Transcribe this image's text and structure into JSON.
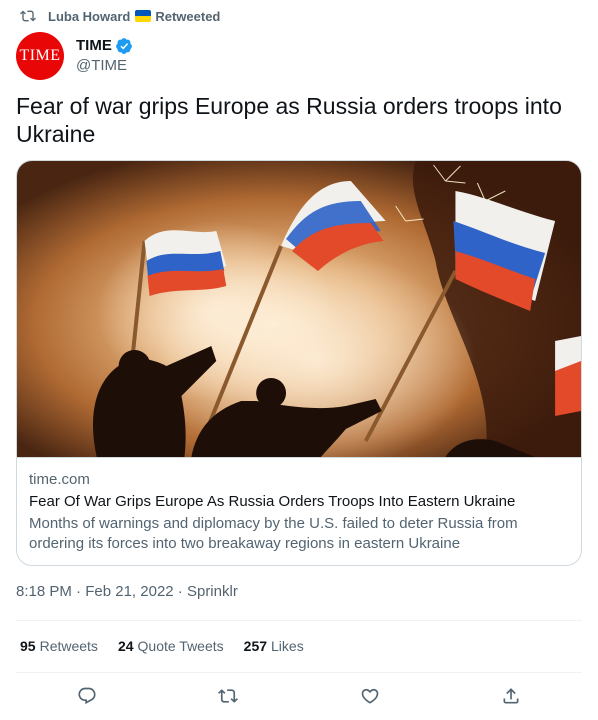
{
  "retweet_header": {
    "retweeter": "Luba Howard",
    "label": "Retweeted",
    "icon": "retweet-icon",
    "flag": "ukraine-flag-emoji"
  },
  "author": {
    "avatar_text": "TIME",
    "avatar_color": "#e90606",
    "display_name": "TIME",
    "handle": "@TIME",
    "verified": true
  },
  "tweet": {
    "text": "Fear of war grips Europe as Russia orders troops into Ukraine"
  },
  "link_card": {
    "image": "crowd-waving-russian-flags-with-fireworks-photo",
    "domain": "time.com",
    "title": "Fear Of War Grips Europe As Russia Orders Troops Into Eastern Ukraine",
    "description": "Months of warnings and diplomacy by the U.S. failed to deter Russia from ordering its forces into two breakaway regions in eastern Ukraine"
  },
  "meta": {
    "time": "8:18 PM",
    "separator": " · ",
    "date": "Feb 21, 2022",
    "source": "Sprinklr"
  },
  "stats": {
    "retweets_count": "95",
    "retweets_label": "Retweets",
    "quotes_count": "24",
    "quotes_label": "Quote Tweets",
    "likes_count": "257",
    "likes_label": "Likes"
  },
  "actions": [
    "reply-icon",
    "retweet-icon",
    "like-icon",
    "share-icon"
  ],
  "colors": {
    "text_primary": "#0f1419",
    "text_secondary": "#536471",
    "border": "#cfd9de",
    "verified_blue": "#1d9bf0"
  }
}
